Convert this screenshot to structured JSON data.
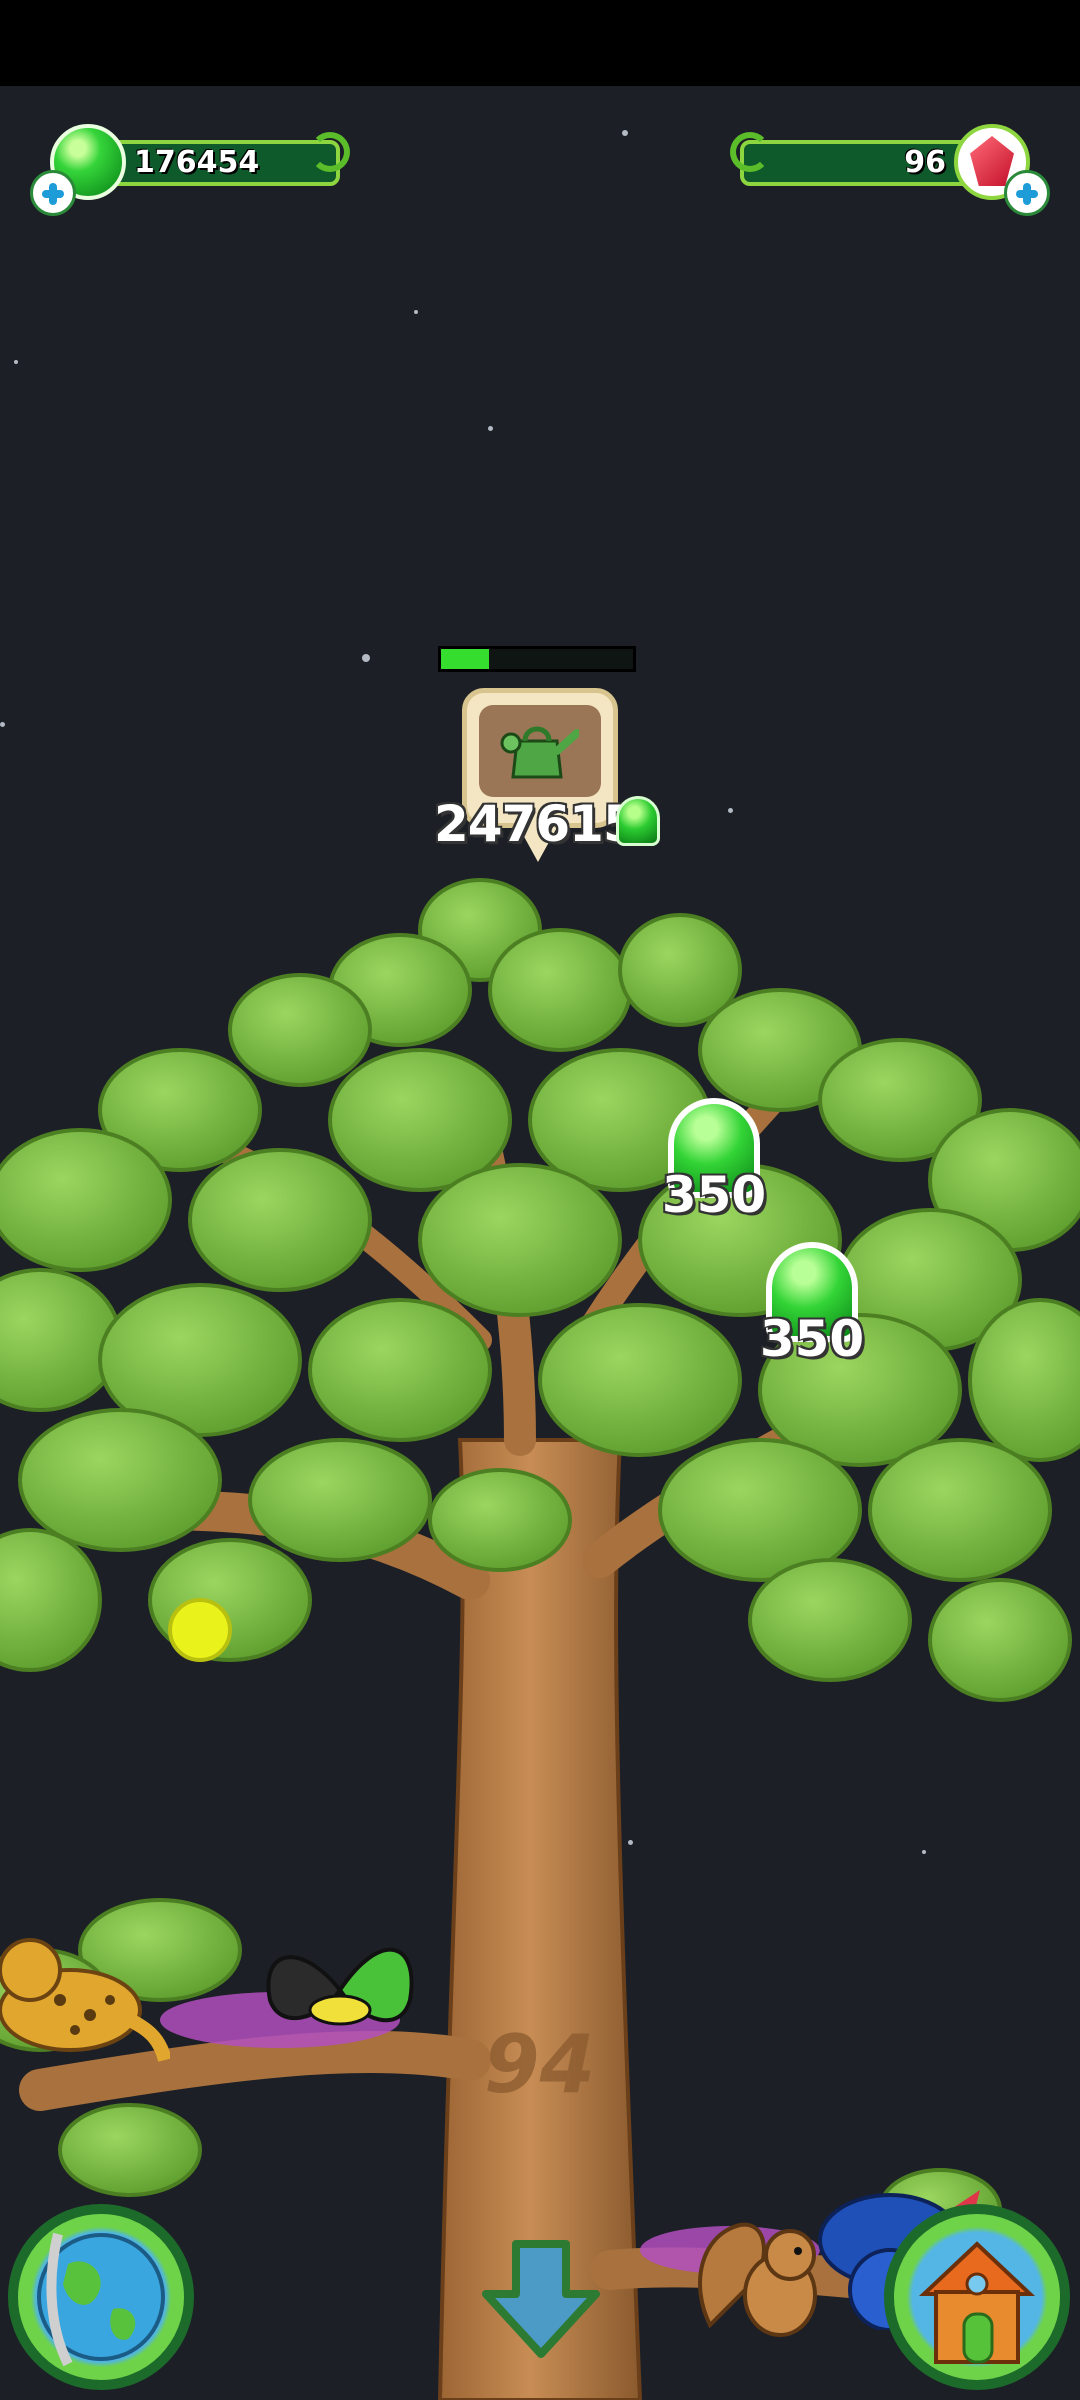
{
  "hud": {
    "left_currency": {
      "value": "176454",
      "icon": "green-gem-icon"
    },
    "right_currency": {
      "value": "96",
      "icon": "red-crystal-icon"
    }
  },
  "watering": {
    "progress": 0.25,
    "cost": "247615",
    "icon": "watering-can-icon"
  },
  "rewards": [
    {
      "value": "350",
      "icon": "green-gem-icon"
    },
    {
      "value": "350",
      "icon": "green-gem-icon"
    }
  ],
  "tree": {
    "level_number": "94"
  },
  "buttons": {
    "globe": "globe-icon",
    "down": "down-arrow-icon",
    "home": "house-icon"
  },
  "colors": {
    "background": "#1c2026",
    "hud_bar": "#0f5a2a",
    "hud_border": "#8ed63f",
    "progress_fill": "#35dd2f"
  }
}
